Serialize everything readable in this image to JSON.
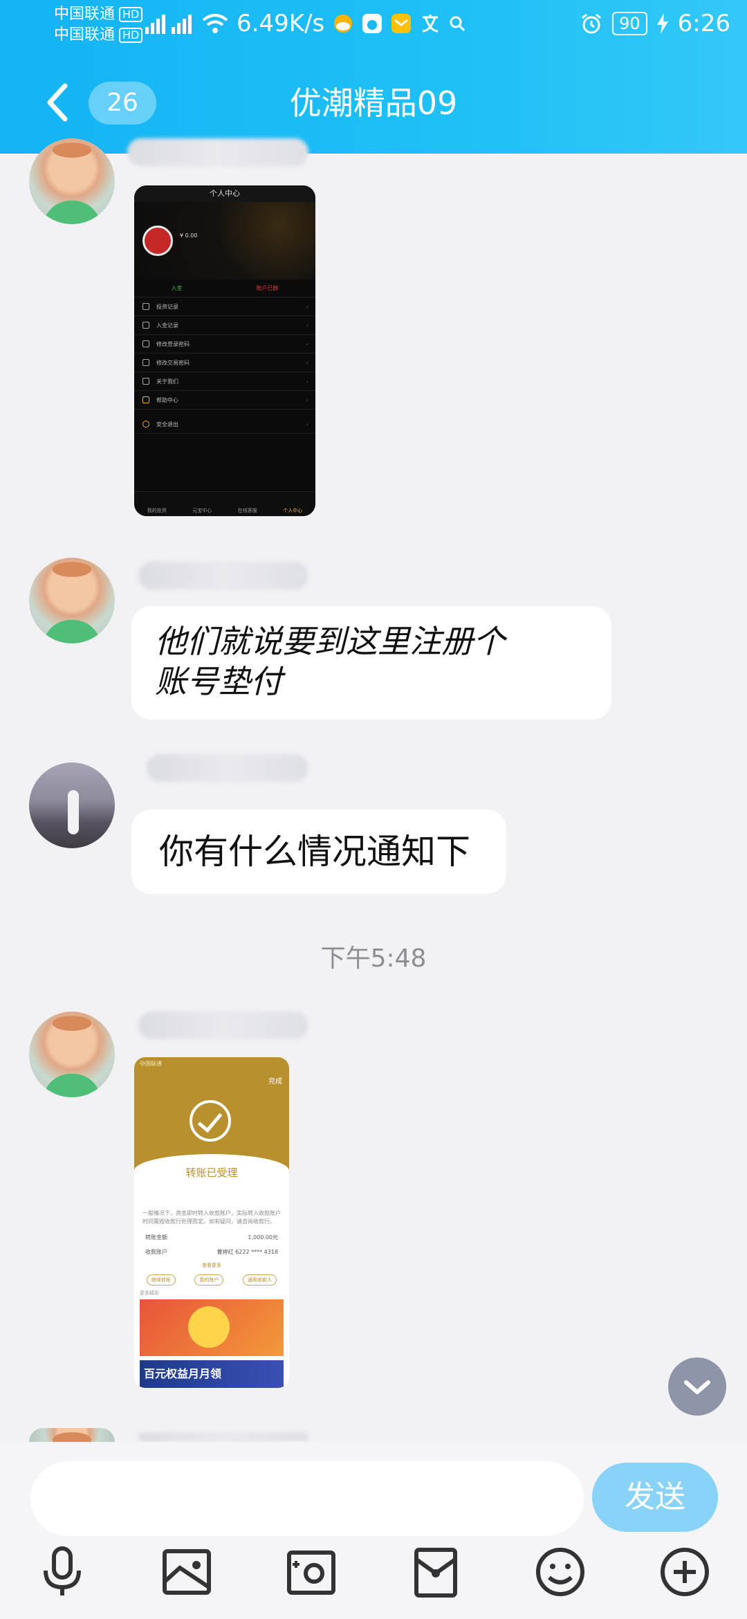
{
  "status_bar": {
    "carrier1": "中国联通",
    "carrier2": "中国联通",
    "hd_badge": "HD",
    "net_speed": "6.49K/s",
    "battery": "90",
    "time": "6:26"
  },
  "header": {
    "unread_count": "26",
    "title": "优潮精品09"
  },
  "messages": [
    {
      "type": "image",
      "sender": "baby-avatar"
    },
    {
      "type": "text",
      "sender": "baby-avatar",
      "text_line1": "他们就说要到这里注册个",
      "text_line2": "账号垫付"
    },
    {
      "type": "text",
      "sender": "woman-avatar",
      "text": "你有什么情况通知下"
    },
    {
      "type": "timestamp",
      "text": "下午5:48"
    },
    {
      "type": "image",
      "sender": "baby-avatar"
    }
  ],
  "screenshot1": {
    "title": "个人中心",
    "balance": "¥ 0.00",
    "tab1": "入金",
    "tab2": "账户已删",
    "menu": [
      "投资记录",
      "入金记录",
      "修改登录密码",
      "修改交易密码",
      "关于我们",
      "帮助中心",
      "安全退出"
    ],
    "nav": [
      "我的投资",
      "元宝中心",
      "在线客服",
      "个人中心"
    ]
  },
  "screenshot2": {
    "carrier": "中国联通",
    "done": "完成",
    "heading": "转账已受理",
    "desc": "一般情况下，资金即时转入收款账户，实际转入收款账户时间需按收款行处理而定。如有疑问，请咨询收款行。",
    "amount_label": "转账金额",
    "amount_value": "1,000.00元",
    "account_label": "收款账户",
    "account_value": "曹婷红 6222 **** 4318",
    "more_label": "查看更多",
    "btn1": "继续转账",
    "btn2": "我的账户",
    "btn3": "通用收款人",
    "more_activities": "更多精彩",
    "banner2_text": "百元权益月月领"
  },
  "composer": {
    "placeholder": "",
    "send_label": "发送"
  },
  "colors": {
    "header_blue": "#18b7f6",
    "send_button": "#88d3f7",
    "background": "#f2f2f4"
  }
}
